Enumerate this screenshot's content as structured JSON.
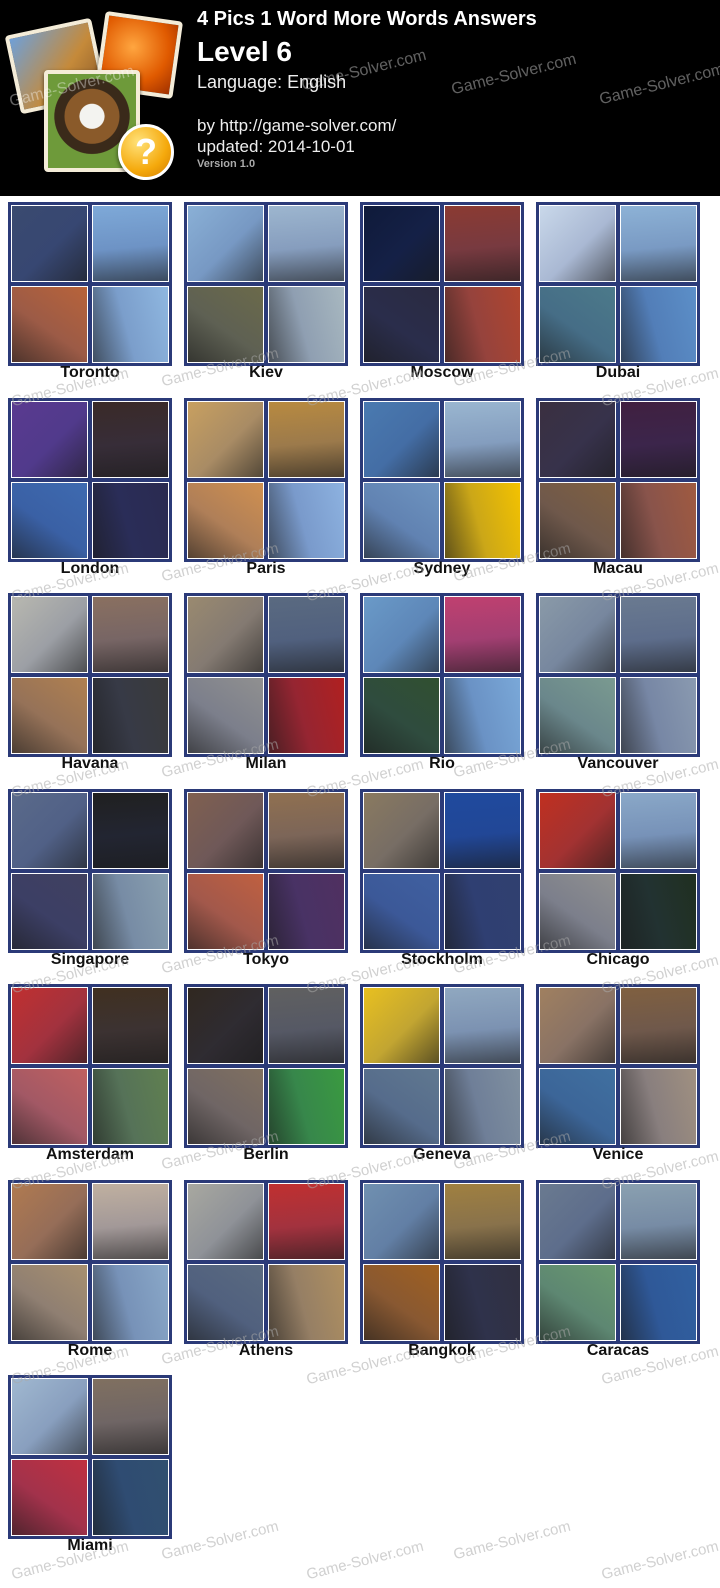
{
  "header": {
    "title": "4 Pics 1 Word More Words Answers",
    "level": "Level 6",
    "language": "Language: English",
    "by": "by http://game-solver.com/",
    "updated": "updated: 2014-10-01",
    "version": "Version 1.0",
    "watermark": "Game-Solver.com"
  },
  "answers": [
    {
      "word": "Toronto",
      "colors": [
        "#3a4a70",
        "#7ea9d8",
        "#b8633a",
        "#8fb7e0"
      ]
    },
    {
      "word": "Kiev",
      "colors": [
        "#8ab0d6",
        "#9db6cf",
        "#6b6a4a",
        "#a8b8c0"
      ]
    },
    {
      "word": "Moscow",
      "colors": [
        "#0f1a3a",
        "#8b3a32",
        "#2a2a40",
        "#b0452e"
      ]
    },
    {
      "word": "Dubai",
      "colors": [
        "#c9d8ea",
        "#8db2d6",
        "#4c7a8a",
        "#5c8fc8"
      ]
    },
    {
      "word": "London",
      "colors": [
        "#5a3a90",
        "#3a2a28",
        "#3e6ab0",
        "#2a2a50"
      ]
    },
    {
      "word": "Paris",
      "colors": [
        "#c8a060",
        "#b88a40",
        "#d09050",
        "#8db2e0"
      ]
    },
    {
      "word": "Sydney",
      "colors": [
        "#4a7ab0",
        "#9ab6d0",
        "#6e94c0",
        "#f3c200"
      ]
    },
    {
      "word": "Macau",
      "colors": [
        "#3a3040",
        "#402040",
        "#806040",
        "#a05a40"
      ]
    },
    {
      "word": "Havana",
      "colors": [
        "#b8b8b0",
        "#8a7060",
        "#b08050",
        "#3a3a3a"
      ]
    },
    {
      "word": "Milan",
      "colors": [
        "#9a8a70",
        "#5a6a80",
        "#909090",
        "#b02020"
      ]
    },
    {
      "word": "Rio",
      "colors": [
        "#6a9ac8",
        "#c04070",
        "#305030",
        "#7aa8d8"
      ]
    },
    {
      "word": "Vancouver",
      "colors": [
        "#8a9aa8",
        "#6a7a90",
        "#7a9a90",
        "#8a9ab0"
      ]
    },
    {
      "word": "Singapore",
      "colors": [
        "#5a6a8a",
        "#202020",
        "#404060",
        "#8aa0b0"
      ]
    },
    {
      "word": "Tokyo",
      "colors": [
        "#806050",
        "#907050",
        "#c06040",
        "#503060"
      ]
    },
    {
      "word": "Stockholm",
      "colors": [
        "#8a7a60",
        "#1f4a9e",
        "#4060a0",
        "#304070"
      ]
    },
    {
      "word": "Chicago",
      "colors": [
        "#c03020",
        "#8aa8c8",
        "#909090",
        "#203020"
      ]
    },
    {
      "word": "Amsterdam",
      "colors": [
        "#c03030",
        "#403020",
        "#c06060",
        "#608050"
      ]
    },
    {
      "word": "Berlin",
      "colors": [
        "#302820",
        "#606060",
        "#807060",
        "#3a9a40"
      ]
    },
    {
      "word": "Geneva",
      "colors": [
        "#e8c020",
        "#90a8c0",
        "#607890",
        "#8090a0"
      ]
    },
    {
      "word": "Venice",
      "colors": [
        "#a08060",
        "#806040",
        "#4070a0",
        "#a09080"
      ]
    },
    {
      "word": "Rome",
      "colors": [
        "#b07a50",
        "#c0b0a0",
        "#a89070",
        "#8aa8c8"
      ]
    },
    {
      "word": "Athens",
      "colors": [
        "#a8a8a0",
        "#c03030",
        "#5a6a80",
        "#b09060"
      ]
    },
    {
      "word": "Bangkok",
      "colors": [
        "#7090b0",
        "#a08040",
        "#a06020",
        "#303040"
      ]
    },
    {
      "word": "Caracas",
      "colors": [
        "#6a7a90",
        "#8aa0b0",
        "#6a9a70",
        "#3060a0"
      ]
    },
    {
      "word": "Miami",
      "colors": [
        "#a0b8d0",
        "#807060",
        "#c03040",
        "#305070"
      ]
    }
  ]
}
